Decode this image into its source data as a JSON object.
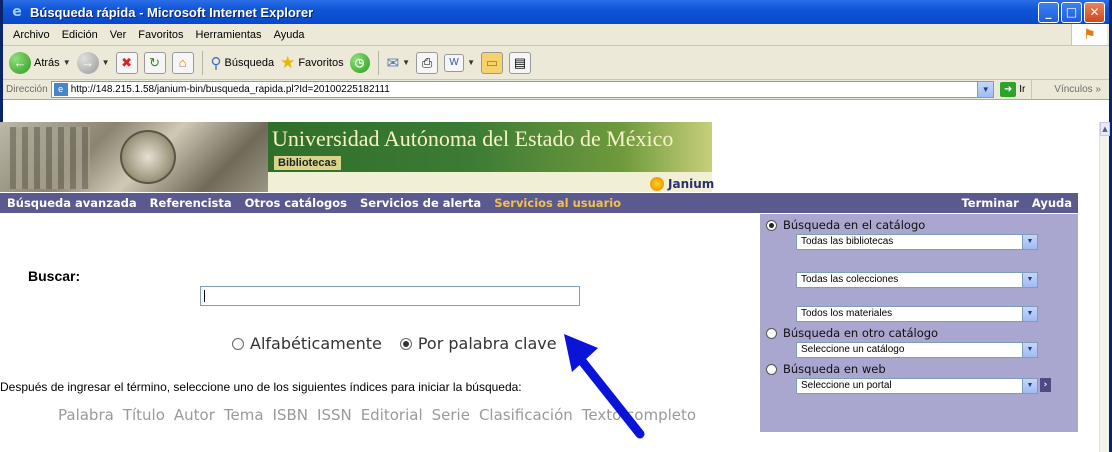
{
  "window": {
    "title": "Búsqueda rápida - Microsoft Internet Explorer",
    "min": "_",
    "max": "□",
    "close": "✕"
  },
  "menubar": [
    "Archivo",
    "Edición",
    "Ver",
    "Favoritos",
    "Herramientas",
    "Ayuda"
  ],
  "toolbar": {
    "back_label": "Atrás",
    "search_label": "Búsqueda",
    "favorites_label": "Favoritos"
  },
  "addressbar": {
    "label": "Dirección",
    "url": "http://148.215.1.58/janium-bin/busqueda_rapida.pl?Id=20100225182111",
    "go_label": "Ir",
    "links_label": "Vínculos"
  },
  "banner": {
    "university": "Universidad Autónoma del Estado de México",
    "library": "Bibliotecas",
    "brand": "Janium"
  },
  "nav": {
    "items": [
      "Búsqueda avanzada",
      "Referencista",
      "Otros catálogos",
      "Servicios de alerta",
      "Servicios al usuario"
    ],
    "active": "Servicios al usuario",
    "right": [
      "Terminar",
      "Ayuda"
    ]
  },
  "search": {
    "label": "Buscar:",
    "value": "",
    "modes": [
      "Alfabéticamente",
      "Por palabra clave"
    ],
    "selected_mode": "Por palabra clave",
    "instruction": "Después de ingresar el término, seleccione uno de los siguientes índices para iniciar la búsqueda:",
    "indexes": [
      "Palabra",
      "Título",
      "Autor",
      "Tema",
      "ISBN",
      "ISSN",
      "Editorial",
      "Serie",
      "Clasificación",
      "Texto completo"
    ]
  },
  "panel": {
    "catalog_label": "Búsqueda en el catálogo",
    "libraries": "Todas las bibliotecas",
    "collections": "Todas las colecciones",
    "materials": "Todos los materiales",
    "other_catalog_label": "Búsqueda en otro catálogo",
    "other_catalog_select": "Seleccione un catálogo",
    "web_label": "Búsqueda en web",
    "web_select": "Seleccione un portal",
    "selected": "Búsqueda en el catálogo"
  },
  "colors": {
    "nav_bg": "#5a5a8e",
    "nav_active": "#f5c04a",
    "panel_bg": "#a9a6cf",
    "annotation_arrow": "#0a14d8"
  }
}
